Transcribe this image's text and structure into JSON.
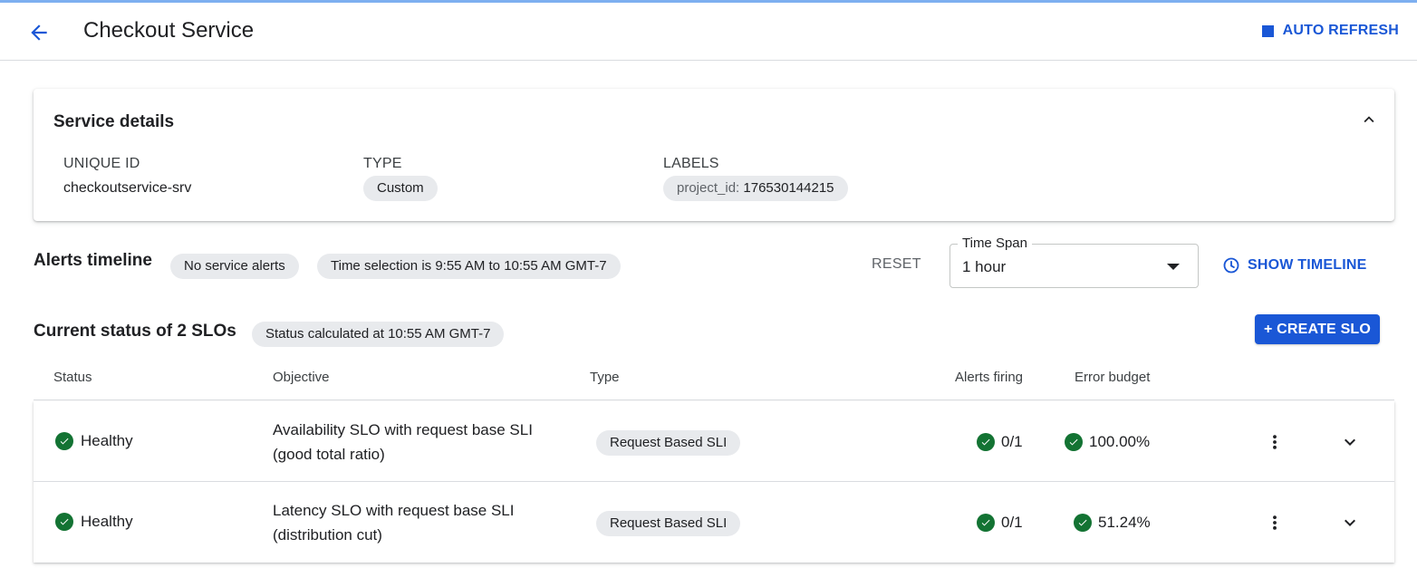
{
  "header": {
    "title": "Checkout Service",
    "auto_refresh_label": "AUTO REFRESH"
  },
  "service_details": {
    "title": "Service details",
    "unique_id_label": "UNIQUE ID",
    "unique_id_value": "checkoutservice-srv",
    "type_label": "TYPE",
    "type_value": "Custom",
    "labels_label": "LABELS",
    "label_key": "project_id:",
    "label_value": "176530144215"
  },
  "alerts_timeline": {
    "title": "Alerts timeline",
    "chip_no_alerts": "No service alerts",
    "chip_time_selection": "Time selection is 9:55 AM to 10:55 AM GMT-7",
    "reset_label": "RESET",
    "time_span_label": "Time Span",
    "time_span_value": "1 hour",
    "show_timeline_label": "SHOW TIMELINE"
  },
  "slo_section": {
    "title": "Current status of 2 SLOs",
    "status_chip": "Status calculated at 10:55 AM GMT-7",
    "create_label": "+ CREATE SLO",
    "columns": [
      "Status",
      "Objective",
      "Type",
      "Alerts firing",
      "Error budget"
    ],
    "rows": [
      {
        "status": "Healthy",
        "objective_line1": "Availability SLO with request base SLI",
        "objective_line2": "(good total ratio)",
        "type": "Request Based SLI",
        "alerts_firing": "0/1",
        "error_budget": "100.00%"
      },
      {
        "status": "Healthy",
        "objective_line1": "Latency SLO with request base SLI",
        "objective_line2": "(distribution cut)",
        "type": "Request Based SLI",
        "alerts_firing": "0/1",
        "error_budget": "51.24%"
      }
    ]
  },
  "colors": {
    "accent": "#1a57d6",
    "healthy": "#137333",
    "chip_bg": "#e8eaed"
  }
}
